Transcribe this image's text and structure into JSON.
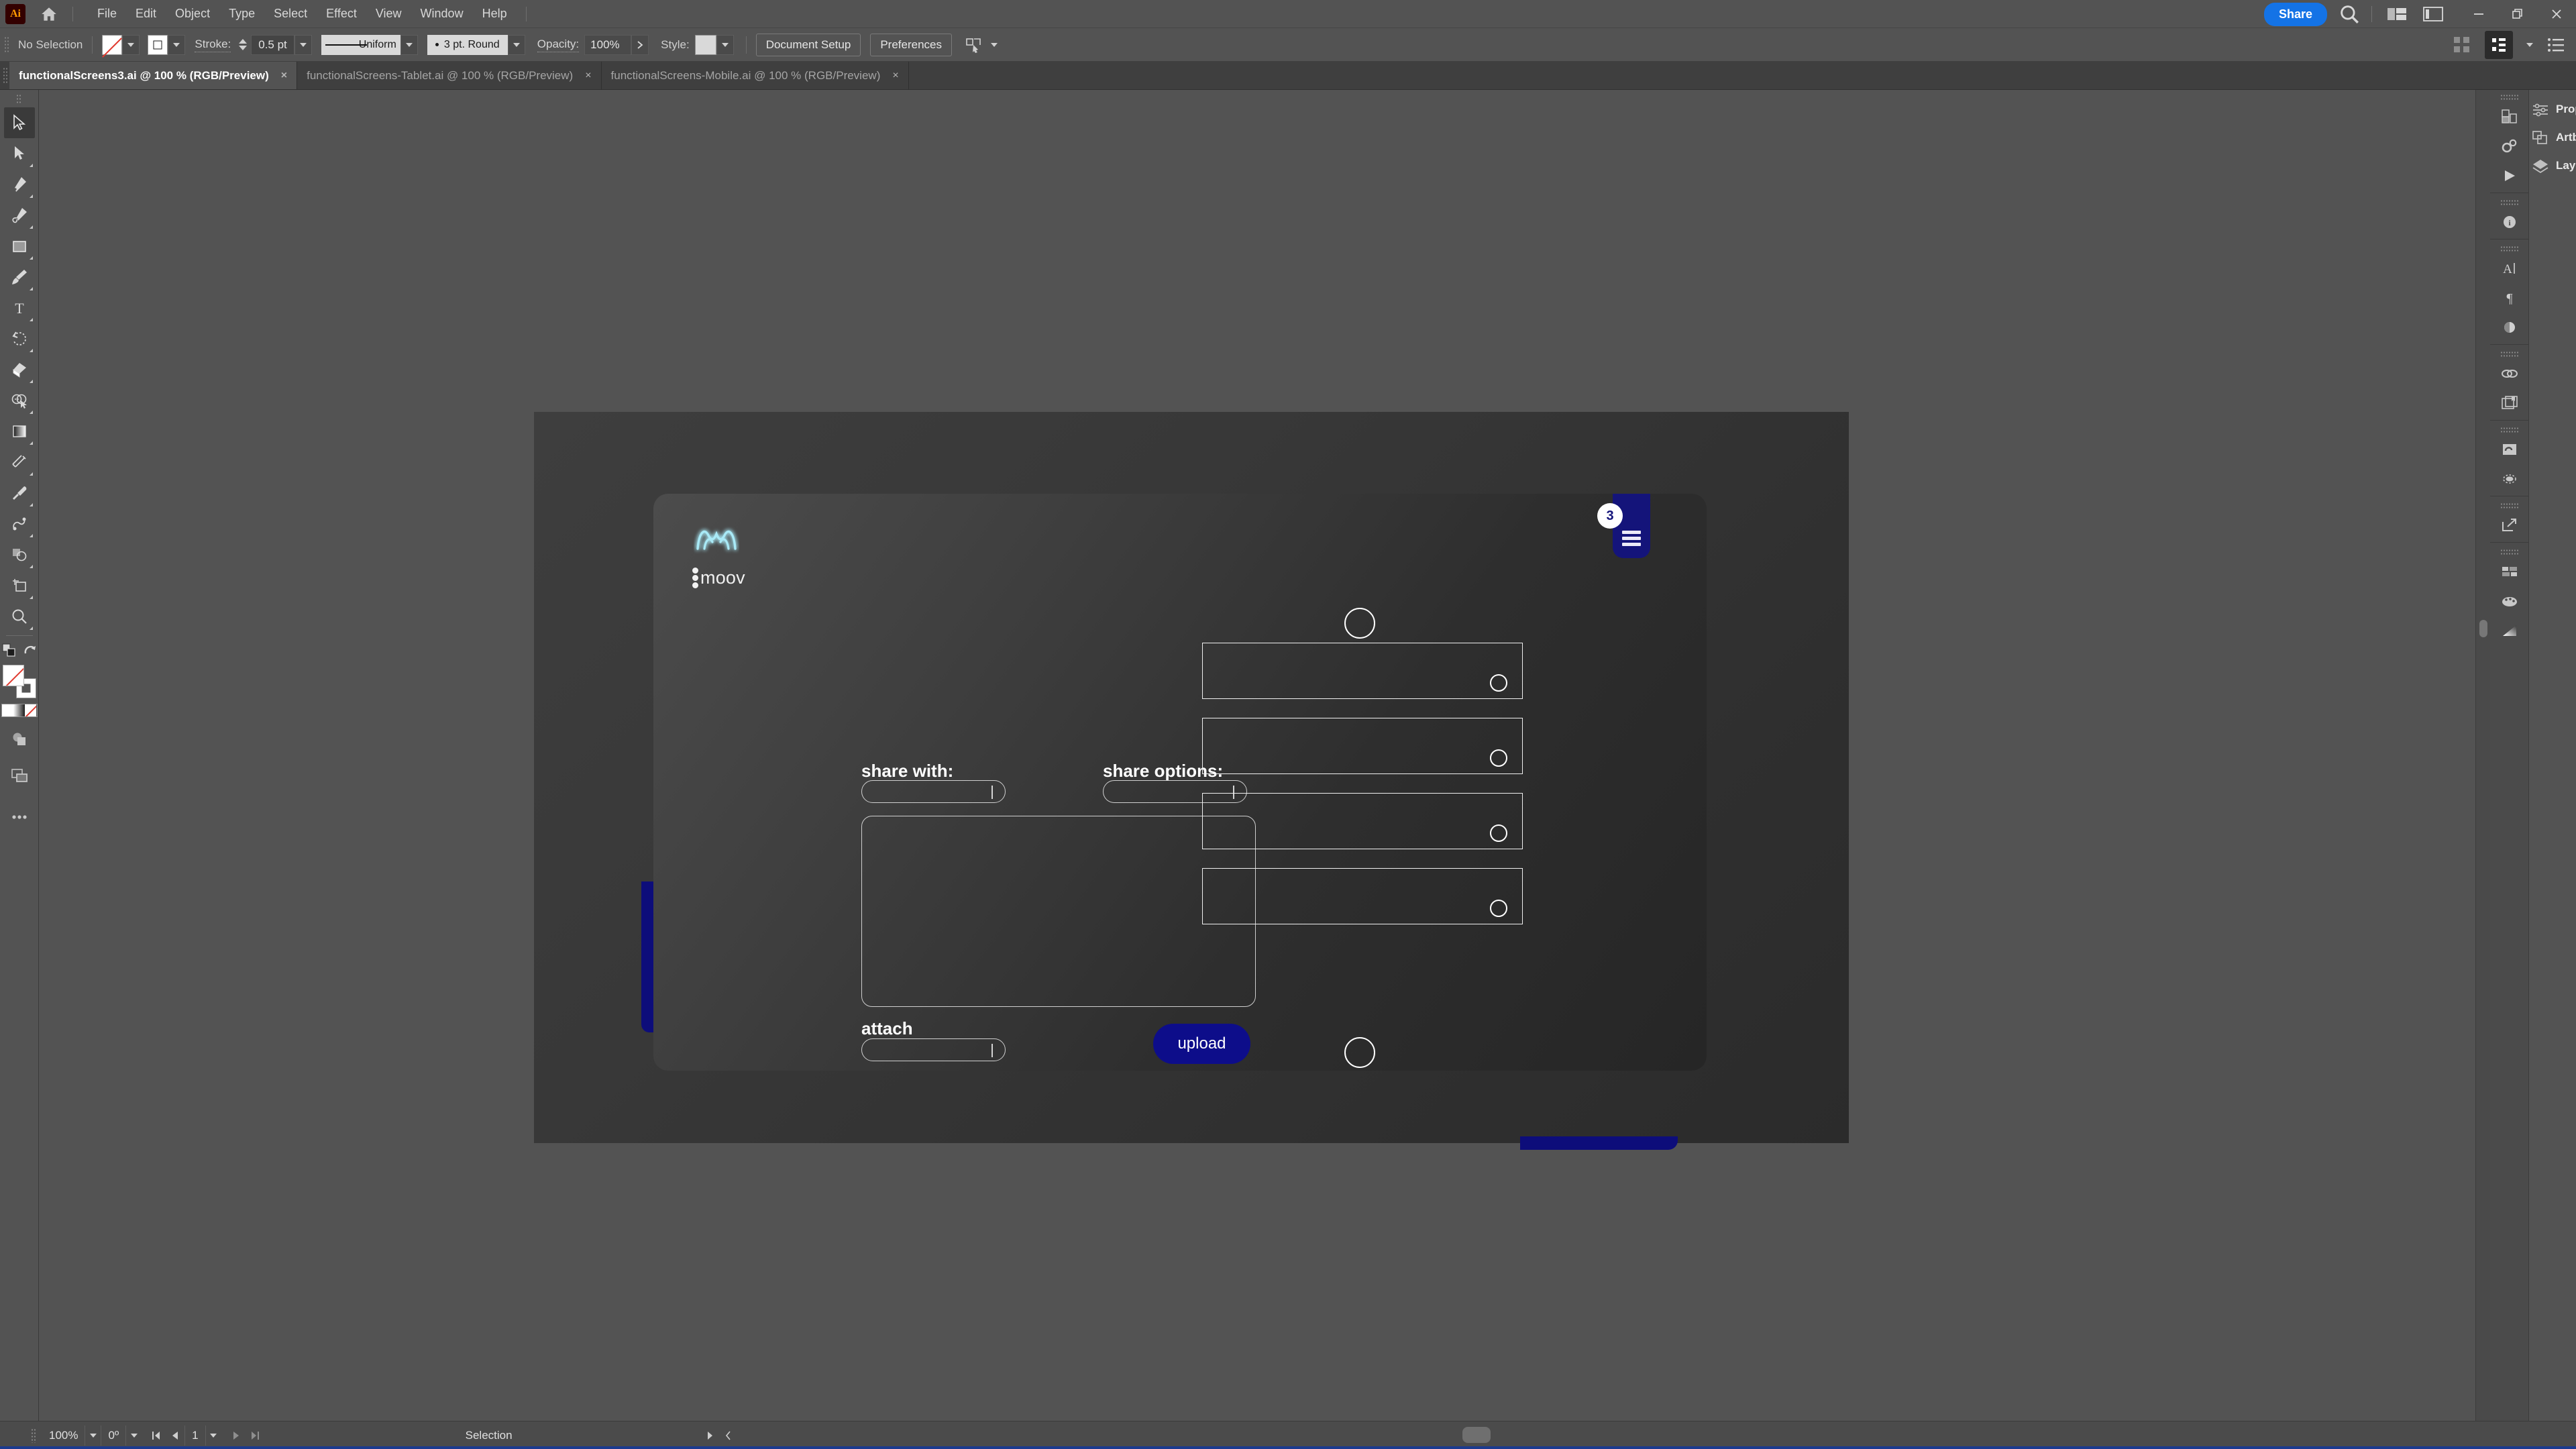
{
  "app": {
    "name": "Adobe Illustrator",
    "logo_text": "Ai"
  },
  "menubar": {
    "items": [
      "File",
      "Edit",
      "Object",
      "Type",
      "Select",
      "Effect",
      "View",
      "Window",
      "Help"
    ],
    "share_label": "Share",
    "icons": [
      "home-icon",
      "search-icon",
      "workspace-switcher-icon",
      "panel-toggle-icon"
    ]
  },
  "window_controls": {
    "minimize": "minimize-icon",
    "maximize": "restore-icon",
    "close": "close-icon"
  },
  "controlbar": {
    "selection_status": "No Selection",
    "fill_swatch": "none-fill",
    "stroke_swatch": "stroke-box",
    "stroke_label": "Stroke:",
    "stroke_weight": "0.5 pt",
    "stroke_profile": "Uniform",
    "brush_definition": "3 pt. Round",
    "opacity_label": "Opacity:",
    "opacity_value": "100%",
    "style_label": "Style:",
    "document_setup_label": "Document Setup",
    "preferences_label": "Preferences"
  },
  "tabs": [
    {
      "title": "functionalScreens3.ai @ 100 % (RGB/Preview)",
      "active": true,
      "close": "×"
    },
    {
      "title": "functionalScreens-Tablet.ai @ 100 % (RGB/Preview)",
      "active": false,
      "close": "×"
    },
    {
      "title": "functionalScreens-Mobile.ai @ 100 % (RGB/Preview)",
      "active": false,
      "close": "×"
    }
  ],
  "toolbar": {
    "tools": [
      "selection-tool",
      "direct-selection-tool",
      "pen-tool",
      "curvature-tool",
      "rectangle-tool",
      "paintbrush-tool",
      "type-tool",
      "rotate-tool",
      "eraser-tool",
      "shape-builder-tool",
      "gradient-tool",
      "width-tool",
      "eyedropper-tool",
      "symbol-sprayer-tool",
      "shaper-tool",
      "artboard-tool",
      "zoom-tool"
    ],
    "bottom_tools": [
      "swap-fill-stroke-icon",
      "default-fill-stroke-icon",
      "fill-stroke-indicator",
      "color-gradient-none-bar",
      "drawing-mode-icon",
      "screen-mode-icon",
      "more-tools-icon"
    ],
    "selected_tool": "selection-tool"
  },
  "artwork": {
    "brand_name": "moov",
    "logo": "moov-m-logo",
    "menu_badge_count": "3",
    "menu_icon": "hamburger-icon",
    "labels": {
      "share_with": "share with:",
      "share_options": "share options:",
      "attach": "attach"
    },
    "upload_label": "upload",
    "inputs": {
      "share_with_value": "",
      "share_options_value": "",
      "attach_value": "",
      "message_value": ""
    },
    "list_rows": [
      {
        "name": "list-row-1"
      },
      {
        "name": "list-row-2"
      },
      {
        "name": "list-row-3"
      },
      {
        "name": "list-row-4"
      }
    ],
    "colors": {
      "accent_navy": "#0d0d8a",
      "menu_navy": "#14147a",
      "logo_glow": "#9fe8f5"
    }
  },
  "right_panel": {
    "items": [
      {
        "label": "Properties",
        "icon": "sliders-icon"
      },
      {
        "label": "Artboards",
        "icon": "artboards-icon"
      },
      {
        "label": "Layers",
        "icon": "layers-icon"
      }
    ],
    "rail_icons": [
      "transform-icon",
      "gears-icon",
      "play-icon",
      "info-icon",
      "character-icon",
      "paragraph-icon",
      "opacity-icon",
      "links-icon",
      "libraries-icon",
      "image-trace-icon",
      "appearance-icon",
      "export-icon",
      "artboards-grid-icon",
      "swatches-icon",
      "gradient-icon"
    ]
  },
  "statusbar": {
    "zoom": "100%",
    "rotation": "0º",
    "artboard_number": "1",
    "status_text": "Selection",
    "nav_first": "first-artboard-icon",
    "nav_prev": "previous-artboard-icon",
    "nav_next": "next-artboard-icon",
    "nav_last": "last-artboard-icon"
  }
}
